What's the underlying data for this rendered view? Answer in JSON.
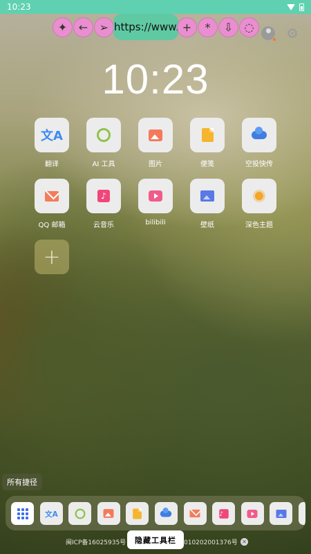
{
  "status_bar": {
    "time": "10:23",
    "wifi_icon": "wifi-icon",
    "battery_icon": "battery-icon"
  },
  "toolbar": {
    "buttons": [
      {
        "name": "compass-button",
        "glyph": "✦"
      },
      {
        "name": "back-button",
        "glyph": "←"
      },
      {
        "name": "send-button",
        "glyph": "➢"
      }
    ],
    "url": "https://www.li",
    "buttons_right": [
      {
        "name": "plus-button",
        "glyph": "+"
      },
      {
        "name": "asterisk-button",
        "glyph": "*"
      },
      {
        "name": "download-button",
        "glyph": "⇩"
      },
      {
        "name": "refresh-button",
        "glyph": "◌"
      }
    ]
  },
  "clock": "10:23",
  "apps": [
    {
      "label": "翻译",
      "icon": "translate-icon"
    },
    {
      "label": "AI 工具",
      "icon": "ai-icon"
    },
    {
      "label": "图片",
      "icon": "photo-icon"
    },
    {
      "label": "便笺",
      "icon": "note-icon"
    },
    {
      "label": "空投快传",
      "icon": "cloud-icon"
    },
    {
      "label": "QQ 邮箱",
      "icon": "mail-icon"
    },
    {
      "label": "云音乐",
      "icon": "music-icon"
    },
    {
      "label": "bilibili",
      "icon": "bilibili-icon"
    },
    {
      "label": "壁纸",
      "icon": "wallpaper-icon"
    },
    {
      "label": "深色主题",
      "icon": "sun-icon"
    }
  ],
  "shortcut_label": "所有捷径",
  "footer": {
    "icp_left": "闽ICP备16025935号",
    "icp_right": "010202001376号",
    "hide_toolbar": "隐藏工具栏",
    "close": "✕"
  }
}
